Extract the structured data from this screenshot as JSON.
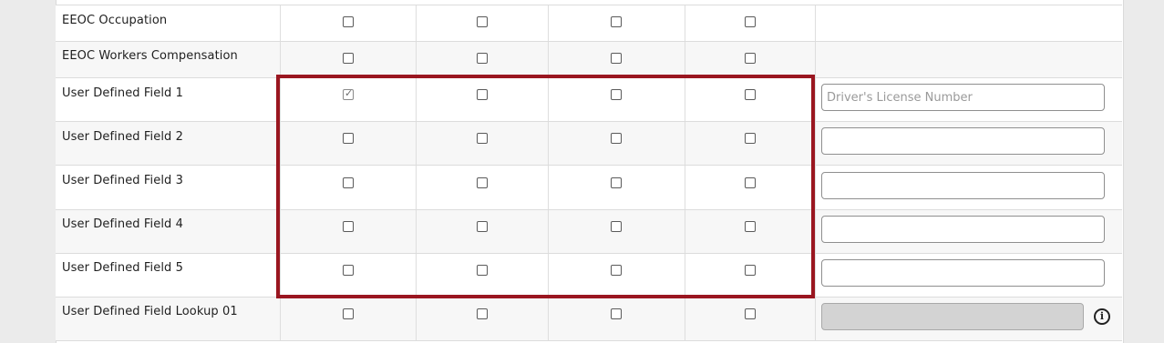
{
  "colors": {
    "highlight": "#9a1620",
    "row_alt": "#f7f7f7",
    "row_white": "#ffffff",
    "page_background": "#ebebeb"
  },
  "rows": [
    {
      "label": "EEOC Occupation",
      "checks": [
        false,
        false,
        false,
        false
      ]
    },
    {
      "label": "EEOC Workers Compensation",
      "checks": [
        false,
        false,
        false,
        false
      ]
    },
    {
      "label": "User Defined Field 1",
      "checks": [
        true,
        false,
        false,
        false
      ],
      "input_value": "",
      "input_placeholder": "Driver's License Number"
    },
    {
      "label": "User Defined Field 2",
      "checks": [
        false,
        false,
        false,
        false
      ],
      "input_value": "",
      "input_placeholder": ""
    },
    {
      "label": "User Defined Field 3",
      "checks": [
        false,
        false,
        false,
        false
      ],
      "input_value": "",
      "input_placeholder": ""
    },
    {
      "label": "User Defined Field 4",
      "checks": [
        false,
        false,
        false,
        false
      ],
      "input_value": "",
      "input_placeholder": ""
    },
    {
      "label": "User Defined Field 5",
      "checks": [
        false,
        false,
        false,
        false
      ],
      "input_value": "",
      "input_placeholder": ""
    },
    {
      "label": "User Defined Field Lookup 01",
      "checks": [
        false,
        false,
        false,
        false
      ],
      "input_value": "",
      "input_placeholder": "",
      "input_disabled": true,
      "icon": "info-icon"
    }
  ]
}
